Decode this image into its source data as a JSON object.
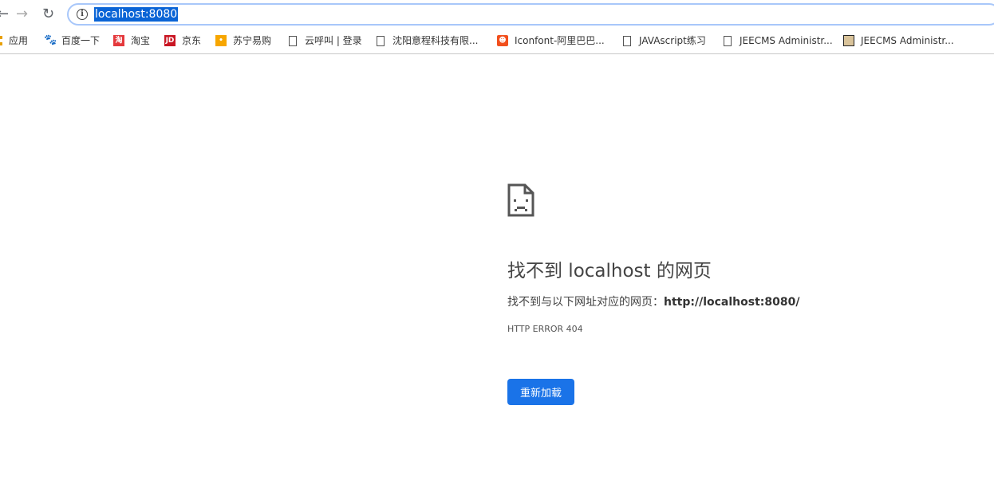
{
  "browser": {
    "url": "localhost:8080"
  },
  "bookmarks": [
    {
      "label": "应用",
      "icon": "apps-icon"
    },
    {
      "label": "百度一下",
      "icon": "baidu-icon"
    },
    {
      "label": "淘宝",
      "icon": "taobao-icon",
      "glyph": "淘",
      "color": "#e4393c"
    },
    {
      "label": "京东",
      "icon": "jd-icon",
      "glyph": "JD",
      "color": "#c91623"
    },
    {
      "label": "苏宁易购",
      "icon": "suning-icon",
      "color": "#f7a600"
    },
    {
      "label": "云呼叫 | 登录",
      "icon": "page-icon"
    },
    {
      "label": "沈阳意程科技有限...",
      "icon": "page-icon"
    },
    {
      "label": "Iconfont-阿里巴巴...",
      "icon": "iconfont-icon",
      "color": "#f24f1d"
    },
    {
      "label": "JAVAscript练习",
      "icon": "page-icon"
    },
    {
      "label": "JEECMS Administr...",
      "icon": "page-icon"
    },
    {
      "label": "JEECMS Administr...",
      "icon": "jeecms-icon"
    }
  ],
  "error": {
    "title": "找不到 localhost 的网页",
    "message": "找不到与以下网址对应的网页：",
    "url": "http://localhost:8080/",
    "code": "HTTP ERROR 404",
    "reload_label": "重新加载"
  }
}
